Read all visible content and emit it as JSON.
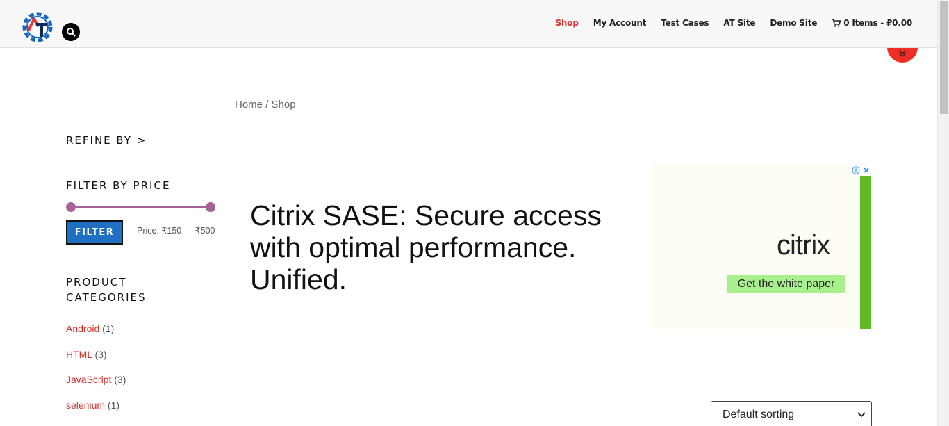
{
  "header": {
    "logo_icon": "automationtesting-gear-logo",
    "nav": [
      {
        "label": "Shop",
        "active": true
      },
      {
        "label": "My Account",
        "active": false
      },
      {
        "label": "Test Cases",
        "active": false
      },
      {
        "label": "AT Site",
        "active": false
      },
      {
        "label": "Demo Site",
        "active": false
      }
    ],
    "cart_label": "0 Items - ₽0.00"
  },
  "breadcrumb": {
    "home": "Home",
    "separator": " / ",
    "current": "Shop"
  },
  "sidebar": {
    "refine_title": "REFINE BY >",
    "filter_price_title": "FILTER BY PRICE",
    "filter_button": "FILTER",
    "price_label": "Price: ₹150 — ₹500",
    "categories_title_line1": "PRODUCT",
    "categories_title_line2": "CATEGORIES",
    "categories": [
      {
        "name": "Android",
        "count": "(1)"
      },
      {
        "name": "HTML",
        "count": "(3)"
      },
      {
        "name": "JavaScript",
        "count": "(3)"
      },
      {
        "name": "selenium",
        "count": "(1)"
      }
    ]
  },
  "ad": {
    "headline": "Citrix SASE: Secure access with optimal performance. Unified.",
    "brand": "citrix",
    "cta": "Get the white paper"
  },
  "sorting": {
    "selected": "Default sorting"
  },
  "colors": {
    "accent": "#e1312e",
    "button": "#1f6fc3",
    "slider": "#a46497",
    "link": "#d1332c"
  }
}
